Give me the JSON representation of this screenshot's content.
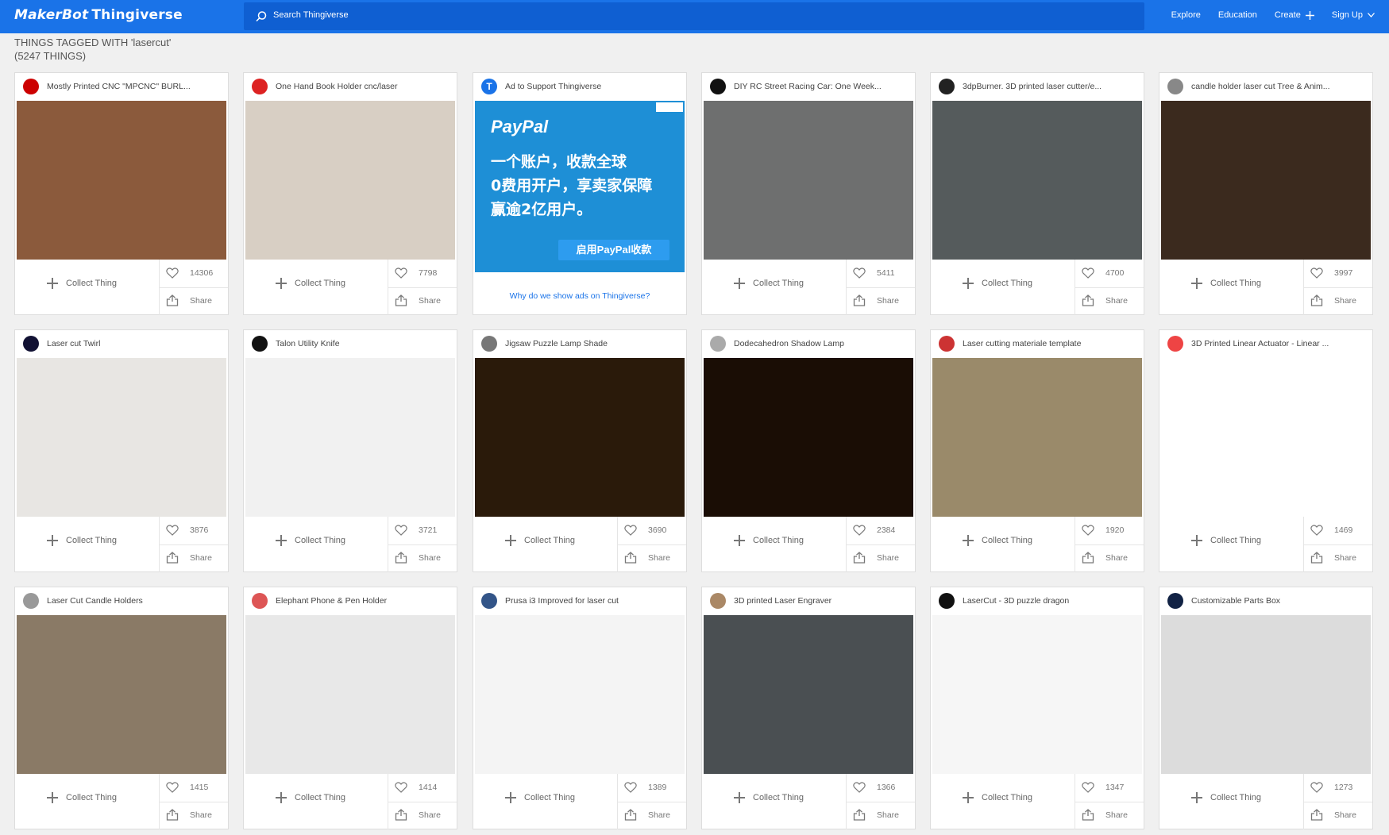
{
  "header": {
    "logo_part1": "MakerBot",
    "logo_part2": "Thingiverse",
    "search_placeholder": "Search Thingiverse",
    "nav": [
      "Explore",
      "Education",
      "Create",
      "Sign Up"
    ]
  },
  "tag": {
    "title": "THINGS TAGGED WITH 'lasercut'",
    "count": "(5247 THINGS)"
  },
  "labels": {
    "collect": "Collect Thing",
    "share": "Share"
  },
  "ad": {
    "header": "Ad to Support Thingiverse",
    "brand": "PayPal",
    "line1": "一个账户，收款全球",
    "line2": "0费用开户，享卖家保障",
    "line3": "赢逾2亿用户。",
    "button": "启用PayPal收款",
    "link": "Why do we show ads on Thingiverse?"
  },
  "cards": [
    {
      "title": "Mostly Printed CNC \"MPCNC\" BURL...",
      "likes": "14306"
    },
    {
      "title": "One Hand Book Holder cnc/laser",
      "likes": "7798"
    },
    {
      "title": "DIY RC Street Racing Car: One Week...",
      "likes": "5411"
    },
    {
      "title": "3dpBurner. 3D printed laser cutter/e...",
      "likes": "4700"
    },
    {
      "title": "candle holder laser cut Tree & Anim...",
      "likes": "3997"
    },
    {
      "title": "Laser cut Twirl",
      "likes": "3876"
    },
    {
      "title": "Talon Utility Knife",
      "likes": "3721"
    },
    {
      "title": "Jigsaw Puzzle Lamp Shade",
      "likes": "3690"
    },
    {
      "title": "Dodecahedron Shadow Lamp",
      "likes": "2384"
    },
    {
      "title": "Laser cutting materiale template",
      "likes": "1920"
    },
    {
      "title": "3D Printed Linear Actuator - Linear ...",
      "likes": "1469"
    },
    {
      "title": "Laser Cut Candle Holders",
      "likes": "1415"
    },
    {
      "title": "Elephant Phone & Pen Holder",
      "likes": "1414"
    },
    {
      "title": "Prusa i3 Improved for laser cut",
      "likes": "1389"
    },
    {
      "title": "3D printed Laser Engraver",
      "likes": "1366"
    },
    {
      "title": "LaserCut - 3D puzzle dragon",
      "likes": "1347"
    },
    {
      "title": "Customizable Parts Box",
      "likes": "1273"
    }
  ],
  "colors": {
    "brand": "#1a73e8",
    "search_bg": "#0f5fd2",
    "paypal_ad": "#1e8fd6"
  }
}
